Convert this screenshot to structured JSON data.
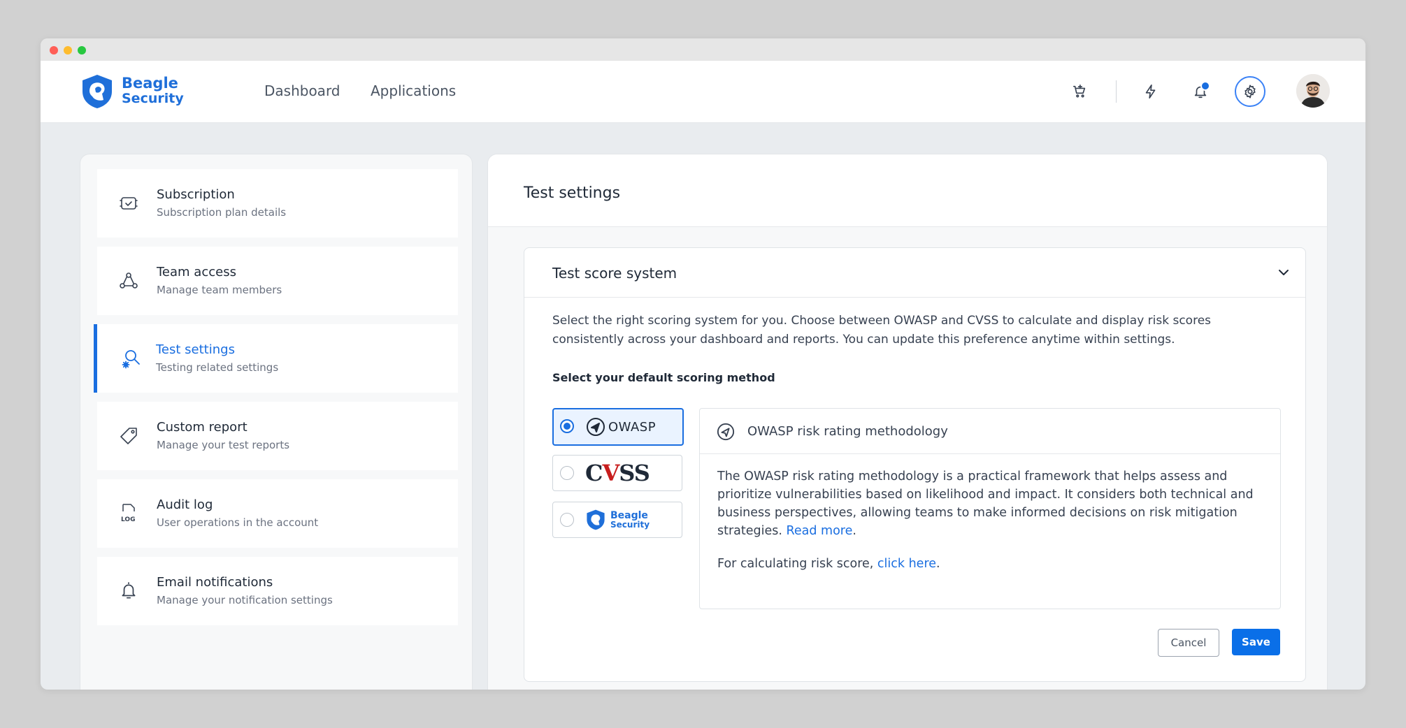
{
  "brand": {
    "line1": "Beagle",
    "line2": "Security",
    "color": "#1f6fd9"
  },
  "nav": {
    "links": [
      {
        "label": "Dashboard"
      },
      {
        "label": "Applications"
      }
    ],
    "icons": [
      "cart-icon",
      "bolt-icon",
      "bell-icon",
      "gear-icon"
    ],
    "notification_dot": true
  },
  "sidebar": {
    "items": [
      {
        "title": "Subscription",
        "subtitle": "Subscription plan details",
        "icon": "subscription-icon"
      },
      {
        "title": "Team access",
        "subtitle": "Manage team members",
        "icon": "team-icon"
      },
      {
        "title": "Test settings",
        "subtitle": "Testing related settings",
        "icon": "test-settings-icon",
        "active": true
      },
      {
        "title": "Custom report",
        "subtitle": "Manage your test reports",
        "icon": "tag-icon"
      },
      {
        "title": "Audit log",
        "subtitle": "User operations in the account",
        "icon": "log-icon"
      },
      {
        "title": "Email notifications",
        "subtitle": "Manage your notification settings",
        "icon": "bell-icon"
      }
    ]
  },
  "main": {
    "title": "Test settings",
    "card": {
      "title": "Test score system",
      "description": "Select the right scoring system for you. Choose between OWASP and CVSS to calculate and display risk scores consistently across your dashboard and reports. You can update this preference anytime within settings.",
      "label": "Select your default scoring method",
      "options": [
        {
          "name": "OWASP",
          "selected": true
        },
        {
          "name": "CVSS",
          "selected": false
        },
        {
          "name": "Beagle Security",
          "selected": false
        }
      ],
      "detail": {
        "title": "OWASP risk rating methodology",
        "paragraph": "The OWASP risk rating methodology is a practical framework that helps assess and prioritize vulnerabilities based on likelihood and impact. It considers both technical and business perspectives, allowing teams to make informed decisions on risk mitigation strategies. ",
        "read_more": "Read more",
        "calc_prefix": "For calculating risk score, ",
        "calc_link": "click here",
        "period": "."
      },
      "cancel_label": "Cancel",
      "save_label": "Save"
    }
  },
  "colors": {
    "accent": "#1a6ee0",
    "save_button": "#0a6fe8"
  }
}
